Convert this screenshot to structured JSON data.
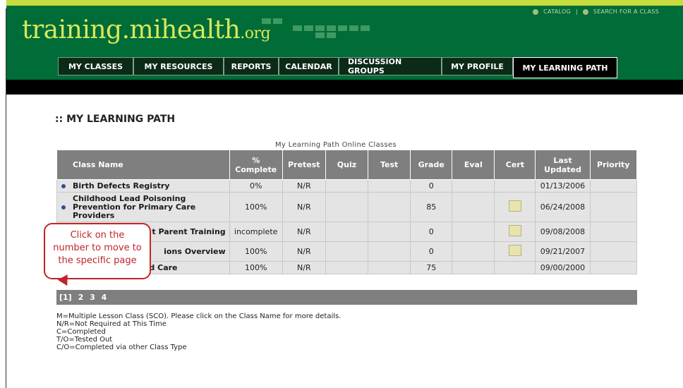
{
  "logo": {
    "main": "training.mihealth",
    "tld": ".org"
  },
  "util_links": {
    "catalog": "CATALOG",
    "separator": "|",
    "search": "SEARCH FOR A CLASS"
  },
  "nav": {
    "tabs": [
      {
        "label": "MY CLASSES"
      },
      {
        "label": "MY RESOURCES"
      },
      {
        "label": "REPORTS"
      },
      {
        "label": "CALENDAR"
      },
      {
        "label": "DISCUSSION GROUPS"
      },
      {
        "label": "MY PROFILE"
      },
      {
        "label": "MY LEARNING PATH"
      }
    ],
    "active": "MY LEARNING PATH"
  },
  "page": {
    "title": ":: MY LEARNING PATH"
  },
  "table": {
    "caption": "My Learning Path Online Classes",
    "headers": {
      "class_name": "Class Name",
      "complete": "% Complete",
      "pretest": "Pretest",
      "quiz": "Quiz",
      "test": "Test",
      "grade": "Grade",
      "eval": "Eval",
      "cert": "Cert",
      "last_updated": "Last Updated",
      "priority": "Priority"
    },
    "rows": [
      {
        "name": "Birth Defects Registry",
        "complete": "0%",
        "pretest": "N/R",
        "quiz": "",
        "test": "",
        "grade": "0",
        "eval": "",
        "cert": false,
        "last_updated": "01/13/2006",
        "priority": ""
      },
      {
        "name": "Childhood Lead Poisoning Prevention for Primary Care Providers",
        "complete": "100%",
        "pretest": "N/R",
        "quiz": "",
        "test": "",
        "grade": "85",
        "eval": "",
        "cert": true,
        "last_updated": "06/24/2008",
        "priority": ""
      },
      {
        "name": "t Parent Training",
        "complete": "incomplete",
        "pretest": "N/R",
        "quiz": "",
        "test": "",
        "grade": "0",
        "eval": "",
        "cert": true,
        "last_updated": "09/08/2008",
        "priority": ""
      },
      {
        "name": "ions Overview",
        "complete": "100%",
        "pretest": "N/R",
        "quiz": "",
        "test": "",
        "grade": "0",
        "eval": "",
        "cert": true,
        "last_updated": "09/21/2007",
        "priority": ""
      },
      {
        "name": "Medicaid Managed Care",
        "complete": "100%",
        "pretest": "N/R",
        "quiz": "",
        "test": "",
        "grade": "75",
        "eval": "",
        "cert": false,
        "last_updated": "09/00/2000",
        "priority": ""
      }
    ]
  },
  "pager": {
    "pages": [
      "[1]",
      "2",
      "3",
      "4"
    ],
    "current": "[1]"
  },
  "legend": {
    "lines": [
      "M=Multiple Lesson Class (SCO). Please click on the Class Name for more details.",
      "N/R=Not Required at This Time",
      "C=Completed",
      "T/O=Tested Out",
      "C/O=Completed via other Class Type"
    ]
  },
  "callout": {
    "lines": [
      "Click on the",
      "number to move to",
      "the specific page"
    ]
  },
  "colors": {
    "header_green": "#006c38",
    "logo_text": "#d8e85a",
    "table_header": "#7f7f7f",
    "callout_red": "#c0242a"
  },
  "icons": {
    "catalog": "book-icon",
    "search": "globe-icon",
    "row_bullet": "bullet-icon",
    "cert": "certificate-icon"
  }
}
